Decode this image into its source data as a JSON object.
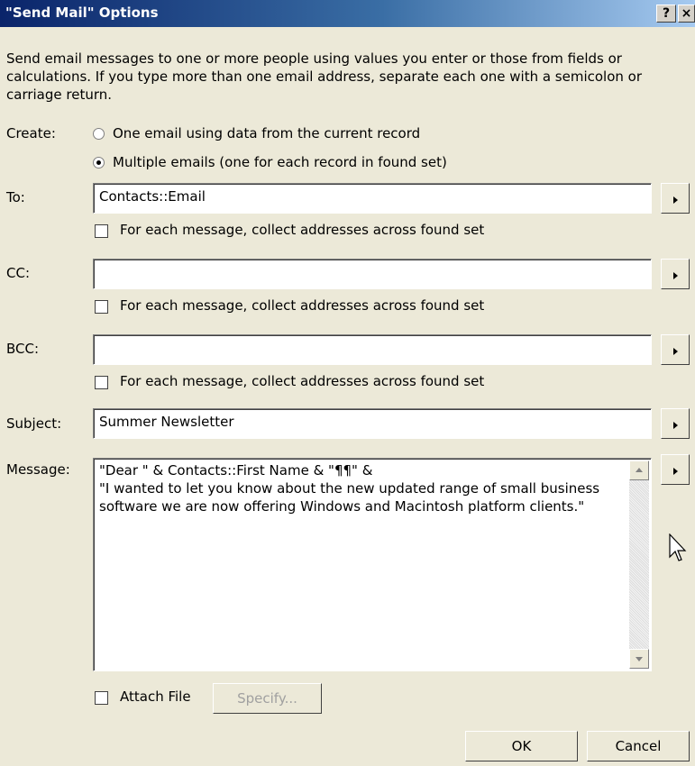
{
  "window": {
    "title": "\"Send Mail\" Options",
    "help_label": "?",
    "close_label": "×"
  },
  "description": "Send email messages to one or more people using values you enter or those from fields or calculations. If you type more than one email address, separate each one with a semicolon or carriage return.",
  "create": {
    "label": "Create:",
    "options": [
      {
        "label": "One email using data from the current record",
        "selected": false
      },
      {
        "label": "Multiple emails (one for each record in found set)",
        "selected": true
      }
    ]
  },
  "to": {
    "label": "To:",
    "value": "Contacts::Email",
    "collect_label": "For each message, collect addresses across found set",
    "collect_checked": false
  },
  "cc": {
    "label": "CC:",
    "value": "",
    "collect_label": "For each message, collect addresses across found set",
    "collect_checked": false
  },
  "bcc": {
    "label": "BCC:",
    "value": "",
    "collect_label": "For each message, collect addresses across found set",
    "collect_checked": false
  },
  "subject": {
    "label": "Subject:",
    "value": "Summer Newsletter"
  },
  "message": {
    "label": "Message:",
    "value": "\"Dear \" & Contacts::First Name & \"¶¶\" &\n\"I wanted to let you know about the new updated range of small business software we are now offering Windows and Macintosh platform clients.\""
  },
  "attach": {
    "label": "Attach File",
    "checked": false,
    "specify_label": "Specify..."
  },
  "buttons": {
    "ok": "OK",
    "cancel": "Cancel"
  },
  "icons": {
    "field_picker": "right-triangle-icon",
    "scroll_up": "up-arrow-icon",
    "scroll_down": "down-arrow-icon",
    "cursor": "mouse-pointer-icon"
  }
}
